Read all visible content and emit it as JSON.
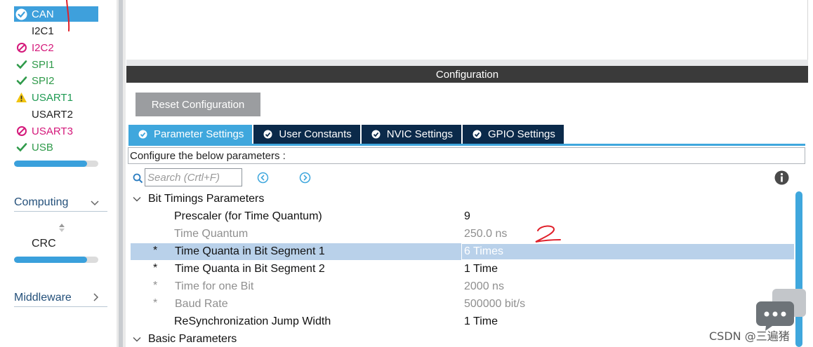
{
  "sidebar": {
    "peripherals": [
      {
        "label": "CAN",
        "status": "ok",
        "selected": true
      },
      {
        "label": "I2C1",
        "status": "none",
        "selected": false
      },
      {
        "label": "I2C2",
        "status": "disabled",
        "selected": false
      },
      {
        "label": "SPI1",
        "status": "ok",
        "selected": false
      },
      {
        "label": "SPI2",
        "status": "ok",
        "selected": false
      },
      {
        "label": "USART1",
        "status": "warning",
        "selected": false
      },
      {
        "label": "USART2",
        "status": "none",
        "selected": false
      },
      {
        "label": "USART3",
        "status": "disabled",
        "selected": false
      },
      {
        "label": "USB",
        "status": "ok",
        "selected": false
      }
    ],
    "connectivity_scroll_fraction": 0.87,
    "categories": {
      "computing": {
        "label": "Computing",
        "icon": "chevron-down-icon"
      },
      "middleware": {
        "label": "Middleware",
        "icon": "chevron-right-icon"
      }
    },
    "computing_items": [
      "CRC"
    ],
    "computing_scroll_fraction": 0.87
  },
  "config": {
    "header": "Configuration",
    "reset_button": "Reset Configuration",
    "tabs": [
      {
        "label": "Parameter Settings",
        "active": true
      },
      {
        "label": "User Constants",
        "active": false
      },
      {
        "label": "NVIC Settings",
        "active": false
      },
      {
        "label": "GPIO Settings",
        "active": false
      }
    ],
    "description": "Configure the below parameters :",
    "search_placeholder": "Search (Crtl+F)",
    "groups": [
      {
        "label": "Bit Timings Parameters",
        "expanded": true,
        "params": [
          {
            "name": "Prescaler (for Time Quantum)",
            "value": "9",
            "editable": false,
            "mark": "",
            "dim": false
          },
          {
            "name": "Time Quantum",
            "value": "250.0 ns",
            "editable": false,
            "mark": "",
            "dim": true
          },
          {
            "name": "Time Quanta in Bit Segment 1",
            "value": "6 Times",
            "editable": true,
            "mark": "*",
            "dim": false,
            "selected": true
          },
          {
            "name": "Time Quanta in Bit Segment 2",
            "value": "1 Time",
            "editable": true,
            "mark": "*",
            "dim": false
          },
          {
            "name": "Time for one Bit",
            "value": "2000 ns",
            "editable": true,
            "mark": "*",
            "dim": true
          },
          {
            "name": "Baud Rate",
            "value": "500000 bit/s",
            "editable": true,
            "mark": "*",
            "dim": true
          },
          {
            "name": "ReSynchronization Jump Width",
            "value": "1 Time",
            "editable": false,
            "mark": "",
            "dim": false
          }
        ]
      },
      {
        "label": "Basic Parameters",
        "expanded": true,
        "params": []
      }
    ]
  },
  "annotations": {
    "mark_1": "1",
    "mark_2": "2"
  },
  "watermark": "CSDN @三遍猪",
  "colors": {
    "accent": "#3fa7dd",
    "tab_inactive": "#0b2a4a",
    "header_bg": "#3a3a3a",
    "ok_green": "#2f9a4a",
    "disabled_pink": "#d4187a",
    "warning_yellow": "#f1c40f",
    "annotation_red": "#e0202a"
  }
}
